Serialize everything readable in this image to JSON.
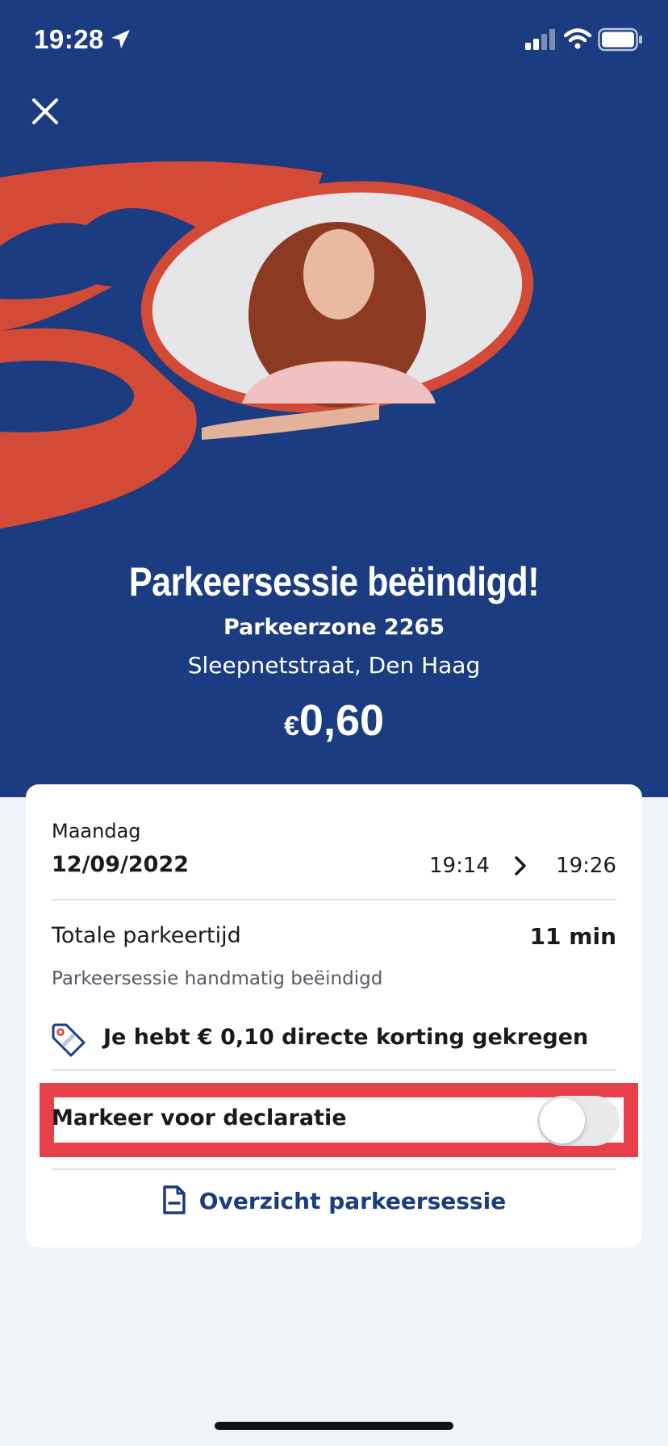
{
  "status_bar": {
    "time": "19:28",
    "icons": [
      "location-arrow-icon",
      "cellular-signal-icon",
      "wifi-icon",
      "battery-icon"
    ]
  },
  "header": {
    "close_icon": "close-icon",
    "brand_color": "#1b3c80",
    "accent_color": "#d34a37"
  },
  "session": {
    "title": "Parkeersessie beëindigd!",
    "zone": "Parkeerzone 2265",
    "address": "Sleepnetstraat, Den Haag",
    "currency": "€",
    "amount": "0,60"
  },
  "card": {
    "day": "Maandag",
    "date": "12/09/2022",
    "start_time": "19:14",
    "end_time": "19:26",
    "total_label": "Totale parkeertijd",
    "total_value": "11 min",
    "ended_note": "Parkeersessie handmatig beëindigd",
    "discount_text": "Je hebt € 0,10 directe korting gekregen",
    "declare_label": "Markeer voor declaratie",
    "declare_toggle_on": false,
    "overview_link": "Overzicht parkeersessie"
  },
  "highlight_color": "#e8404b"
}
